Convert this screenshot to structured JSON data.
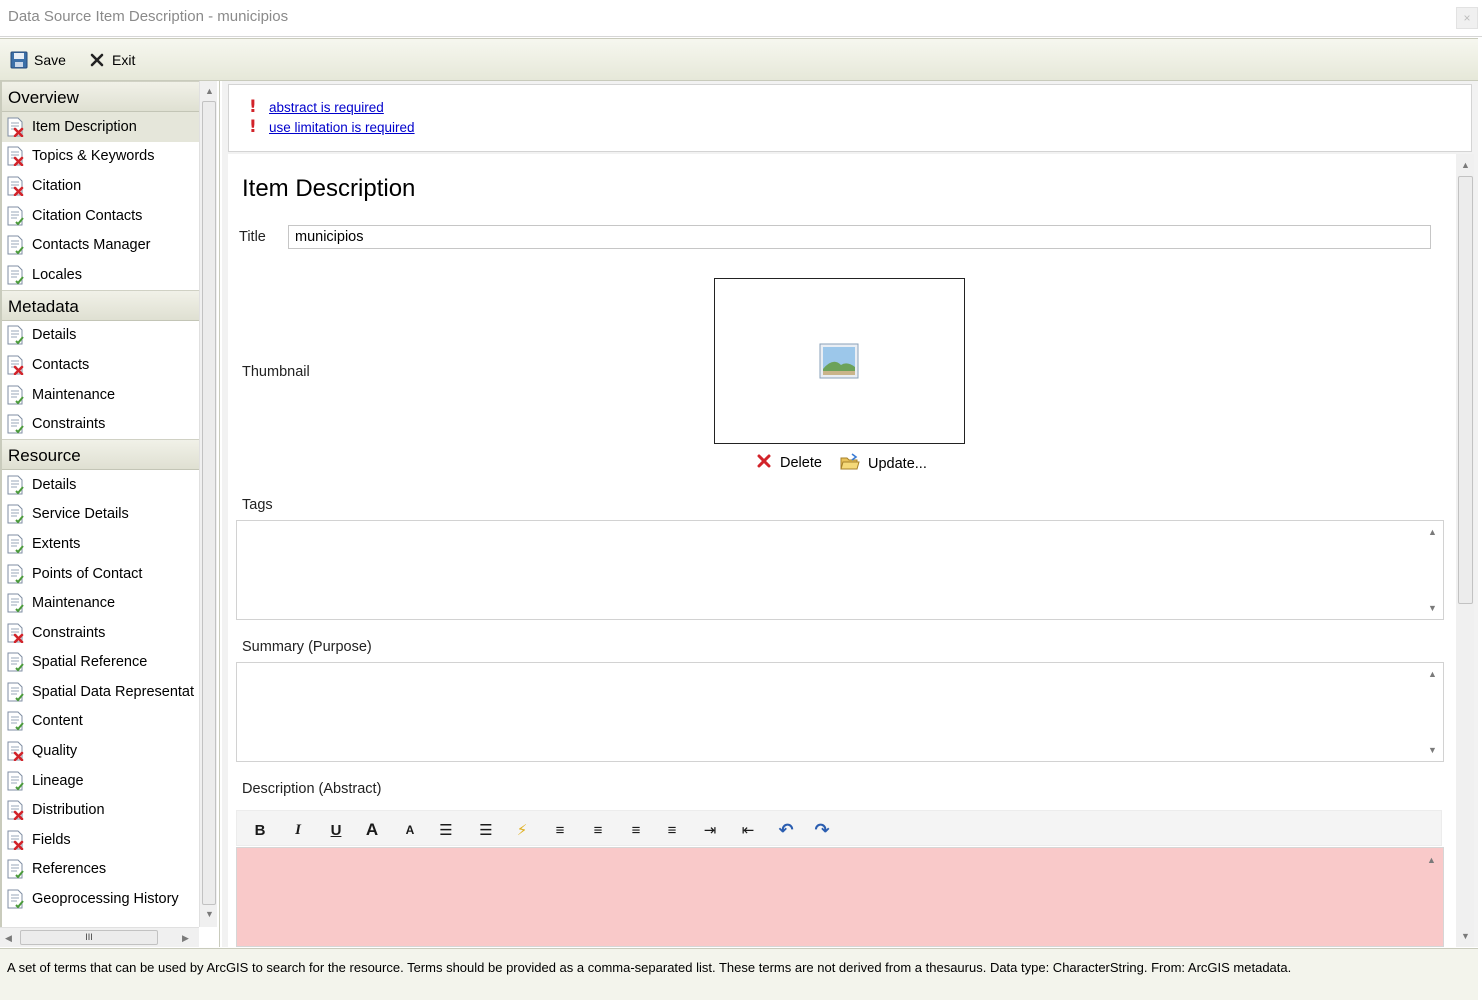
{
  "window": {
    "title": "Data Source Item Description - municipios",
    "close_glyph": "×"
  },
  "toolbar": {
    "save_label": "Save",
    "exit_label": "Exit"
  },
  "sidebar": {
    "groups": [
      {
        "label": "Overview",
        "items": [
          {
            "label": "Item Description",
            "status": "error",
            "selected": true
          },
          {
            "label": "Topics & Keywords",
            "status": "error"
          },
          {
            "label": "Citation",
            "status": "error"
          },
          {
            "label": "Citation Contacts",
            "status": "ok"
          },
          {
            "label": "Contacts Manager",
            "status": "ok"
          },
          {
            "label": "Locales",
            "status": "ok"
          }
        ]
      },
      {
        "label": "Metadata",
        "items": [
          {
            "label": "Details",
            "status": "ok"
          },
          {
            "label": "Contacts",
            "status": "error"
          },
          {
            "label": "Maintenance",
            "status": "ok"
          },
          {
            "label": "Constraints",
            "status": "ok"
          }
        ]
      },
      {
        "label": "Resource",
        "items": [
          {
            "label": "Details",
            "status": "ok"
          },
          {
            "label": "Service Details",
            "status": "ok"
          },
          {
            "label": "Extents",
            "status": "ok"
          },
          {
            "label": "Points of Contact",
            "status": "ok"
          },
          {
            "label": "Maintenance",
            "status": "ok"
          },
          {
            "label": "Constraints",
            "status": "error"
          },
          {
            "label": "Spatial Reference",
            "status": "ok"
          },
          {
            "label": "Spatial Data Representat",
            "status": "ok"
          },
          {
            "label": "Content",
            "status": "ok"
          },
          {
            "label": "Quality",
            "status": "error"
          },
          {
            "label": "Lineage",
            "status": "ok"
          },
          {
            "label": "Distribution",
            "status": "error"
          },
          {
            "label": "Fields",
            "status": "error"
          },
          {
            "label": "References",
            "status": "ok"
          },
          {
            "label": "Geoprocessing History",
            "status": "ok"
          }
        ]
      }
    ],
    "hscroll_grip": "III"
  },
  "errors": [
    {
      "icon": "!",
      "text": "abstract is required"
    },
    {
      "icon": "!",
      "text": "use limitation is required"
    }
  ],
  "form": {
    "heading": "Item Description",
    "title_label": "Title",
    "title_value": "municipios",
    "thumbnail_label": "Thumbnail",
    "delete_label": "Delete",
    "update_label": "Update...",
    "tags_label": "Tags",
    "summary_label": "Summary (Purpose)",
    "description_label": "Description (Abstract)",
    "editor_buttons": [
      {
        "name": "bold-button",
        "glyph": "B"
      },
      {
        "name": "italic-button",
        "glyph": "I"
      },
      {
        "name": "underline-button",
        "glyph": "U"
      },
      {
        "name": "grow-font-button",
        "glyph": "A"
      },
      {
        "name": "shrink-font-button",
        "glyph": "A"
      },
      {
        "name": "bullets-button",
        "glyph": "☰"
      },
      {
        "name": "numbering-button",
        "glyph": "☰"
      },
      {
        "name": "clear-format-button",
        "glyph": "⚡"
      },
      {
        "name": "align-left-button",
        "glyph": "≡"
      },
      {
        "name": "align-center-button",
        "glyph": "≡"
      },
      {
        "name": "align-right-button",
        "glyph": "≡"
      },
      {
        "name": "justify-button",
        "glyph": "≡"
      },
      {
        "name": "indent-button",
        "glyph": "⇥"
      },
      {
        "name": "outdent-button",
        "glyph": "⇤"
      },
      {
        "name": "undo-button",
        "glyph": "↶"
      },
      {
        "name": "redo-button",
        "glyph": "↷"
      }
    ]
  },
  "status_text": "A set of terms that can be used by ArcGIS to search for the resource. Terms should be provided as a comma-separated list. These terms are not derived from a thesaurus. Data type: CharacterString. From: ArcGIS metadata.",
  "colors": {
    "error_red": "#d2232a",
    "link_blue": "#0000cc",
    "required_field_bg": "#f9c9c9",
    "toolbar_bg": "#e6e8d9"
  }
}
